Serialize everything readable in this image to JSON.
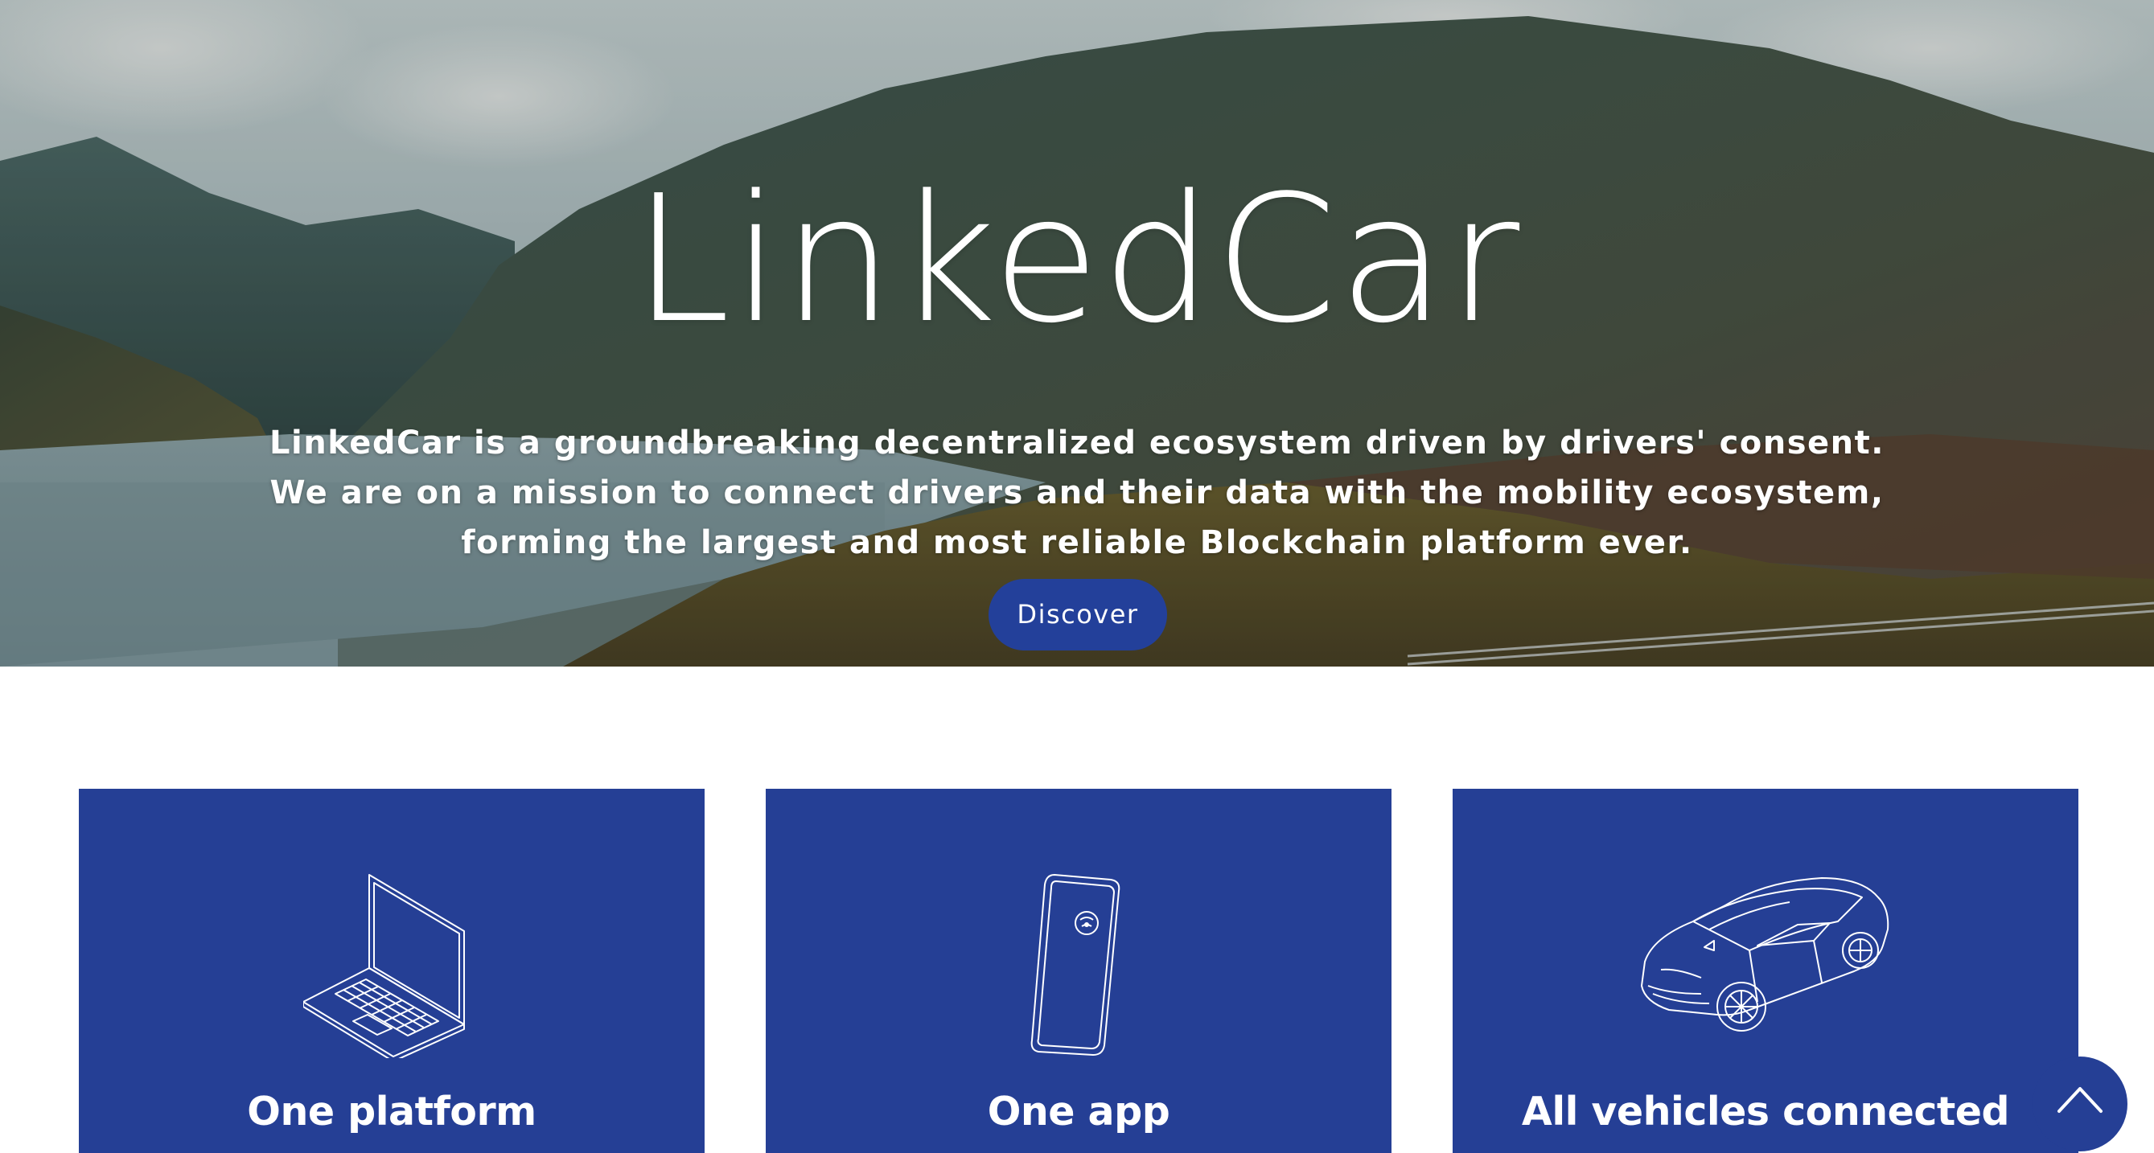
{
  "hero": {
    "logo_text": "LinkedCar",
    "tagline_lines": [
      "LinkedCar is a groundbreaking decentralized ecosystem driven by drivers' consent.",
      "We are on a mission to connect drivers and their data with the mobility ecosystem,",
      "forming the largest and most reliable Blockchain platform ever."
    ],
    "discover_label": "Discover"
  },
  "cards": [
    {
      "title": "One platform",
      "icon": "laptop-icon"
    },
    {
      "title": "One app",
      "icon": "smartphone-icon"
    },
    {
      "title": "All vehicles connected",
      "icon": "car-icon"
    }
  ],
  "scroll_top": {
    "icon": "chevron-up-icon"
  },
  "colors": {
    "brand_blue": "#253f95",
    "button_blue": "#23409a",
    "text_white": "#ffffff"
  }
}
